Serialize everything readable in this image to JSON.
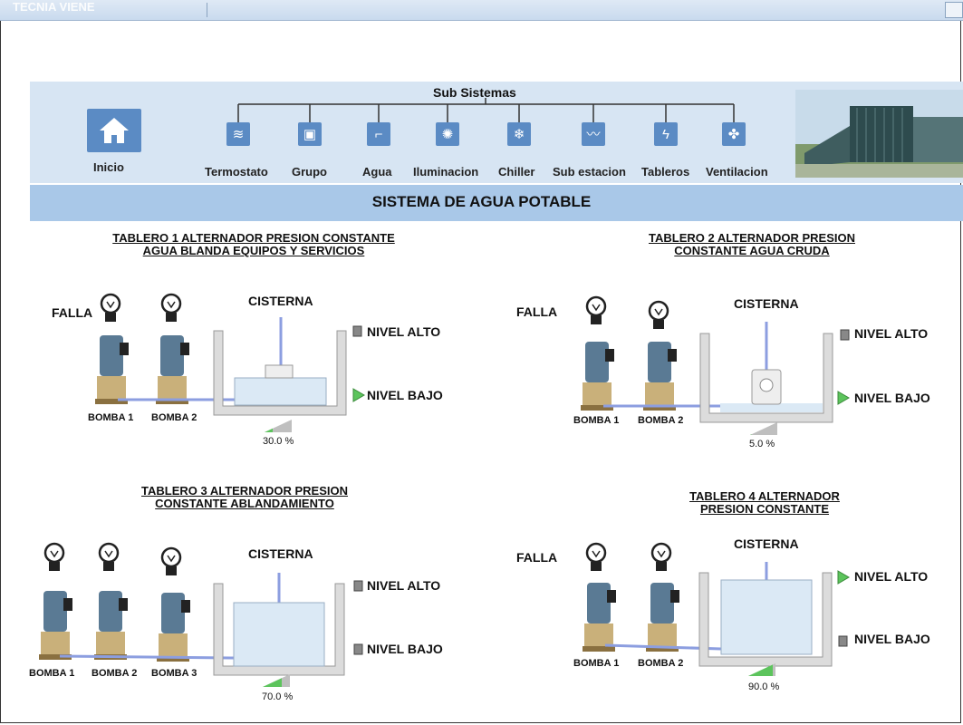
{
  "window": {
    "brand": "TECNIA VIENE"
  },
  "nav": {
    "title": "Sub Sistemas",
    "home_label": "Inicio",
    "items": [
      {
        "label": "Termostato",
        "icon": "thermostat-icon"
      },
      {
        "label": "Grupo",
        "icon": "generator-icon"
      },
      {
        "label": "Agua",
        "icon": "water-tap-icon"
      },
      {
        "label": "Iluminacion",
        "icon": "light-icon"
      },
      {
        "label": "Chiller",
        "icon": "snowflake-icon"
      },
      {
        "label": "Sub estacion",
        "icon": "substation-icon"
      },
      {
        "label": "Tableros",
        "icon": "bolt-icon"
      },
      {
        "label": "Ventilacion",
        "icon": "fan-icon"
      }
    ]
  },
  "system_title": "SISTEMA DE AGUA POTABLE",
  "panels": [
    {
      "title_line1": "TABLERO 1 ALTERNADOR PRESION CONSTANTE",
      "title_line2": "AGUA BLANDA EQUIPOS Y SERVICIOS",
      "falla": "FALLA",
      "cisterna": "CISTERNA",
      "nivel_alto": "NIVEL ALTO",
      "nivel_bajo": "NIVEL BAJO",
      "pumps": [
        "BOMBA 1",
        "BOMBA 2"
      ],
      "level_percent": 30.0,
      "level_text": "30.0 %"
    },
    {
      "title_line1": "TABLERO 2 ALTERNADOR PRESION",
      "title_line2": "CONSTANTE AGUA CRUDA",
      "falla": "FALLA",
      "cisterna": "CISTERNA",
      "nivel_alto": "NIVEL ALTO",
      "nivel_bajo": "NIVEL BAJO",
      "pumps": [
        "BOMBA 1",
        "BOMBA 2"
      ],
      "level_percent": 5.0,
      "level_text": "5.0 %"
    },
    {
      "title_line1": "TABLERO 3 ALTERNADOR PRESION",
      "title_line2": "CONSTANTE ABLANDAMIENTO",
      "cisterna": "CISTERNA",
      "nivel_alto": "NIVEL ALTO",
      "nivel_bajo": "NIVEL BAJO",
      "pumps": [
        "BOMBA 1",
        "BOMBA 2",
        "BOMBA 3"
      ],
      "level_percent": 70.0,
      "level_text": "70.0 %"
    },
    {
      "title_line1": "TABLERO 4 ALTERNADOR",
      "title_line2": "PRESION CONSTANTE",
      "falla": "FALLA",
      "cisterna": "CISTERNA",
      "nivel_alto": "NIVEL ALTO",
      "nivel_bajo": "NIVEL BAJO",
      "pumps": [
        "BOMBA 1",
        "BOMBA 2"
      ],
      "level_percent": 90.0,
      "level_text": "90.0 %"
    }
  ],
  "colors": {
    "accent": "#5b8bc4",
    "band": "#d7e5f3",
    "title_bar": "#a9c8e8",
    "water": "#dbe9f5",
    "pipe": "#8c9ee0",
    "indicator_on": "#5cc45c"
  }
}
